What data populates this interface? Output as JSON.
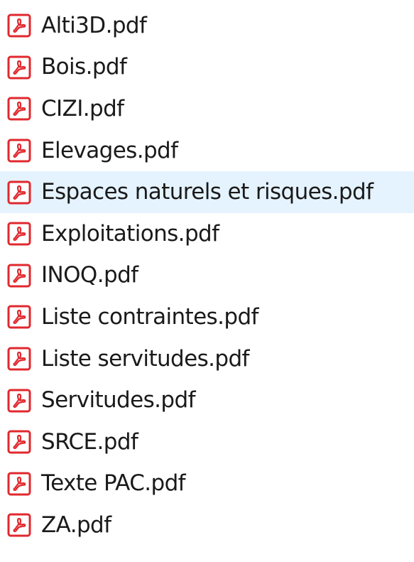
{
  "file_list": {
    "icon": "pdf-file-icon",
    "accent_color": "#e0282e",
    "hover_color": "#e5f3ff",
    "hovered_index": 4,
    "files": [
      {
        "name": "Alti3D.pdf"
      },
      {
        "name": "Bois.pdf"
      },
      {
        "name": "CIZI.pdf"
      },
      {
        "name": "Elevages.pdf"
      },
      {
        "name": "Espaces naturels et risques.pdf"
      },
      {
        "name": "Exploitations.pdf"
      },
      {
        "name": "INOQ.pdf"
      },
      {
        "name": "Liste contraintes.pdf"
      },
      {
        "name": "Liste servitudes.pdf"
      },
      {
        "name": "Servitudes.pdf"
      },
      {
        "name": "SRCE.pdf"
      },
      {
        "name": "Texte PAC.pdf"
      },
      {
        "name": "ZA.pdf"
      }
    ]
  }
}
